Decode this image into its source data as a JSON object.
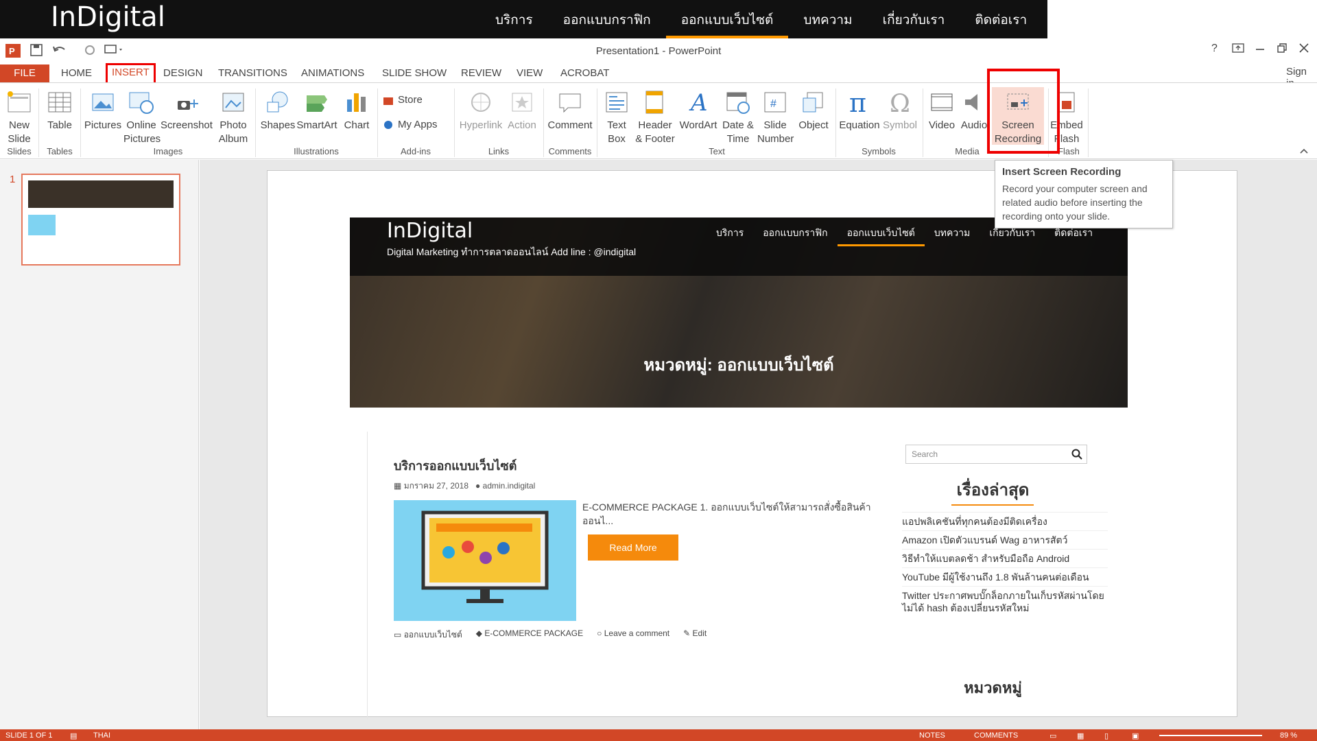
{
  "bg_site": {
    "logo": "InDigital",
    "nav": [
      "บริการ",
      "ออกแบบกราฟิก",
      "ออกแบบเว็บไซต์",
      "บทความ",
      "เกี่ยวกับเรา",
      "ติดต่อเรา"
    ]
  },
  "titlebar": {
    "title": "Presentation1 - PowerPoint",
    "help": "?",
    "sign_in": "Sign in"
  },
  "tabs": [
    "FILE",
    "HOME",
    "INSERT",
    "DESIGN",
    "TRANSITIONS",
    "ANIMATIONS",
    "SLIDE SHOW",
    "REVIEW",
    "VIEW",
    "ACROBAT"
  ],
  "ribbon": {
    "new_slide": "New Slide",
    "table": "Table",
    "pictures": "Pictures",
    "online_pictures": "Online Pictures",
    "screenshot": "Screenshot",
    "photo_album": "Photo Album",
    "shapes": "Shapes",
    "smartart": "SmartArt",
    "chart": "Chart",
    "store": "Store",
    "my_apps": "My Apps",
    "hyperlink": "Hyperlink",
    "action": "Action",
    "comment": "Comment",
    "text_box": "Text Box",
    "header_footer": "Header & Footer",
    "wordart": "WordArt",
    "date_time": "Date & Time",
    "slide_number": "Slide Number",
    "object": "Object",
    "equation": "Equation",
    "symbol": "Symbol",
    "video": "Video",
    "audio": "Audio",
    "screen_recording": "Screen Recording",
    "embed_flash": "Embed Flash",
    "groups": [
      "Slides",
      "Tables",
      "Images",
      "Illustrations",
      "Add-ins",
      "Links",
      "Comments",
      "Text",
      "Symbols",
      "Media",
      "Flash"
    ]
  },
  "tooltip": {
    "title": "Insert Screen Recording",
    "desc": "Record your computer screen and related audio before inserting the recording onto your slide."
  },
  "thumbnail": {
    "number": "1"
  },
  "slide": {
    "logo": "InDigital",
    "tagline": "Digital Marketing ทำการตลาดออนไลน์ Add line : @indigital",
    "nav": [
      "บริการ",
      "ออกแบบกราฟิก",
      "ออกแบบเว็บไซต์",
      "บทความ",
      "เกี่ยวกับเรา",
      "ติดต่อเรา"
    ],
    "category_heading": "หมวดหมู่: ออกแบบเว็บไซต์",
    "post": {
      "title": "บริการออกแบบเว็บไซต์",
      "date": "มกราคม 27, 2018",
      "author": "admin.indigital",
      "excerpt": "E-COMMERCE PACKAGE  1. ออกแบบเว็บไซต์ให้สามารถสั่งซื้อสินค้าออนไ...",
      "read_more": "Read More",
      "category": "ออกแบบเว็บไซต์",
      "tag": "E-COMMERCE PACKAGE",
      "comment": "Leave a comment",
      "edit": "Edit"
    },
    "sidebar": {
      "search_placeholder": "Search",
      "latest_heading": "เรื่องล่าสุด",
      "latest": [
        "แอปพลิเคชันที่ทุกคนต้องมีติดเครื่อง",
        "Amazon เปิดตัวแบรนด์ Wag อาหารสัตว์",
        "วิธีทำให้แบตลดช้า สำหรับมือถือ Android",
        "YouTube มีผู้ใช้งานถึง 1.8 พันล้านคนต่อเดือน",
        "Twitter ประกาศพบบั๊กล็อกภายในเก็บรหัสผ่านโดยไม่ได้ hash ต้องเปลี่ยนรหัสใหม่"
      ],
      "categories_heading": "หมวดหมู่"
    }
  },
  "statusbar": {
    "slide_info": "SLIDE 1 OF 1",
    "language": "THAI",
    "notes": "NOTES",
    "comments": "COMMENTS",
    "zoom": "89 %"
  },
  "colors": {
    "accent": "#d24726",
    "highlight": "#e00000",
    "orange": "#f58a0c"
  }
}
